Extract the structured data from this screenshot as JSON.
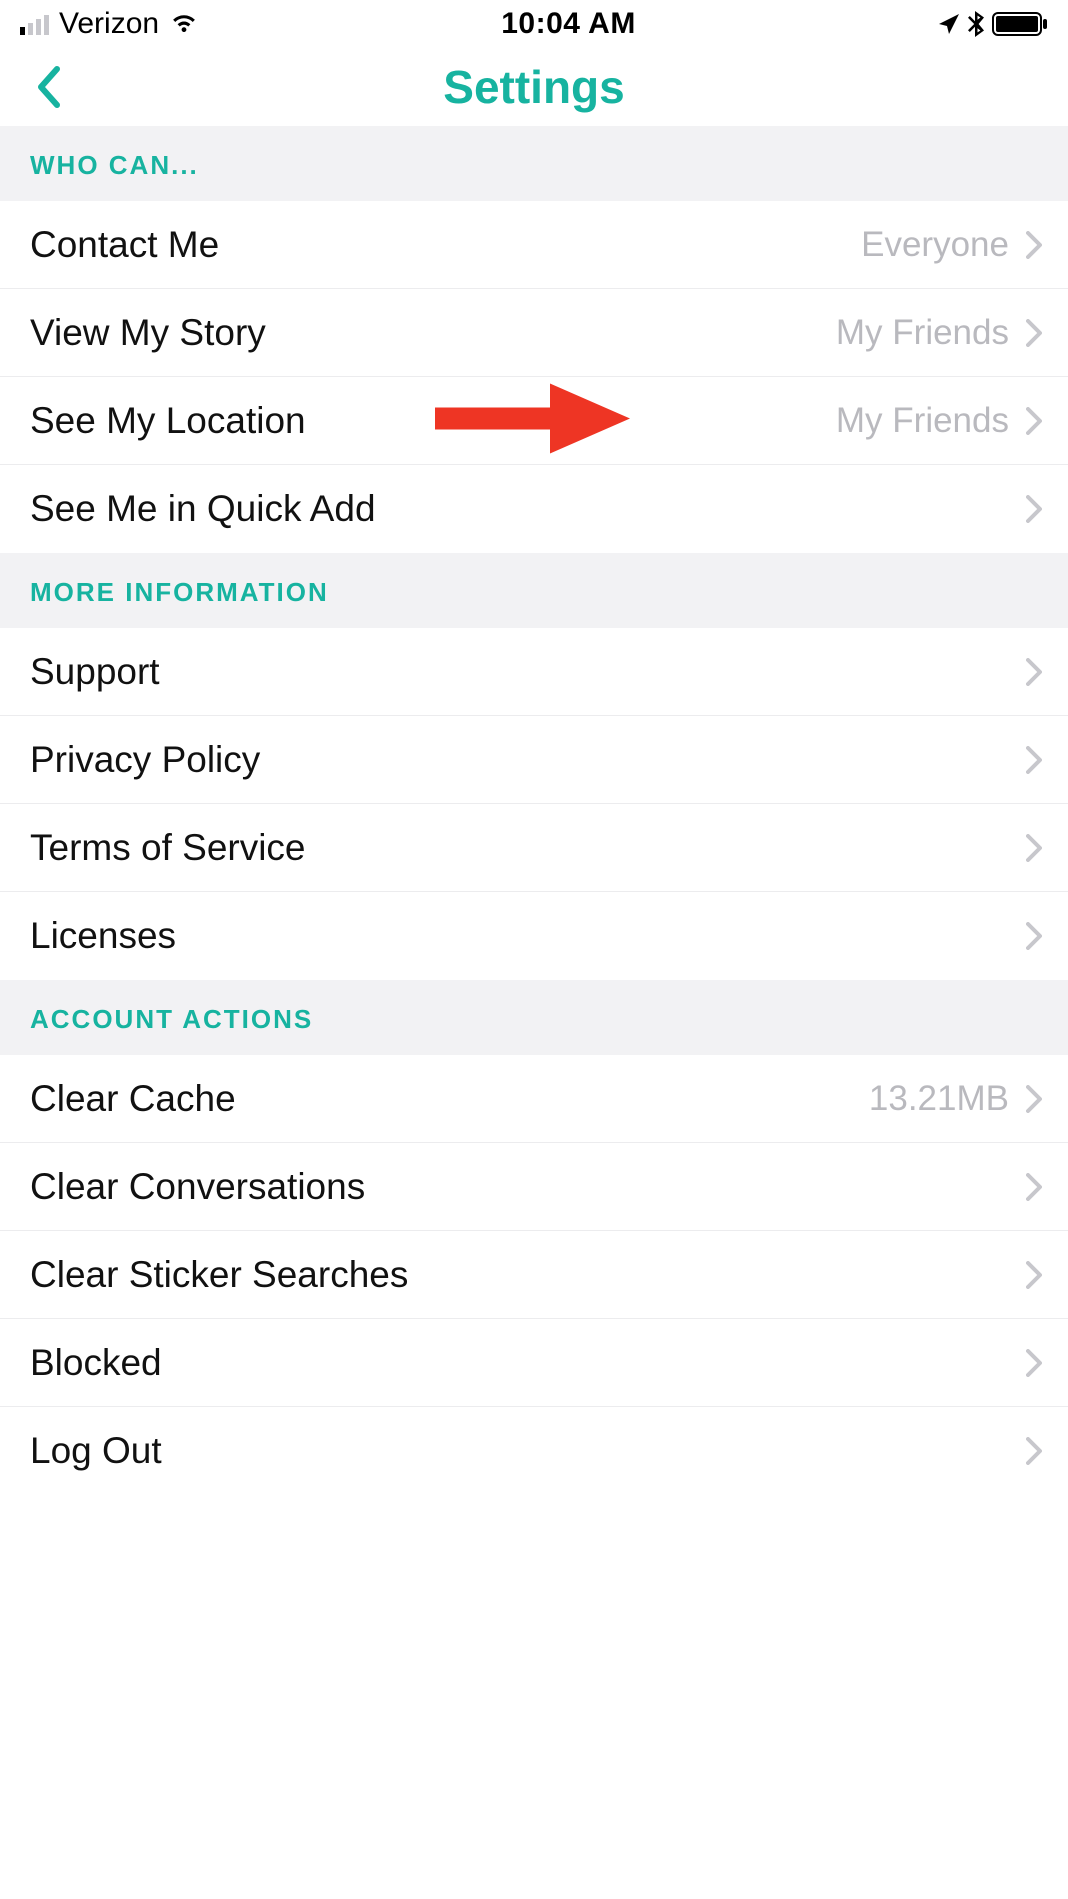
{
  "status": {
    "carrier": "Verizon",
    "time": "10:04 AM"
  },
  "header": {
    "title": "Settings"
  },
  "sections": {
    "who_can": {
      "title": "WHO CAN...",
      "contact_me": {
        "label": "Contact Me",
        "value": "Everyone"
      },
      "view_my_story": {
        "label": "View My Story",
        "value": "My Friends"
      },
      "see_my_location": {
        "label": "See My Location",
        "value": "My Friends"
      },
      "quick_add": {
        "label": "See Me in Quick Add",
        "value": ""
      }
    },
    "more_info": {
      "title": "MORE INFORMATION",
      "support": {
        "label": "Support"
      },
      "privacy": {
        "label": "Privacy Policy"
      },
      "terms": {
        "label": "Terms of Service"
      },
      "licenses": {
        "label": "Licenses"
      }
    },
    "account_actions": {
      "title": "ACCOUNT ACTIONS",
      "clear_cache": {
        "label": "Clear Cache",
        "value": "13.21MB"
      },
      "clear_conversations": {
        "label": "Clear Conversations"
      },
      "clear_sticker": {
        "label": "Clear Sticker Searches"
      },
      "blocked": {
        "label": "Blocked"
      },
      "log_out": {
        "label": "Log Out"
      }
    }
  }
}
